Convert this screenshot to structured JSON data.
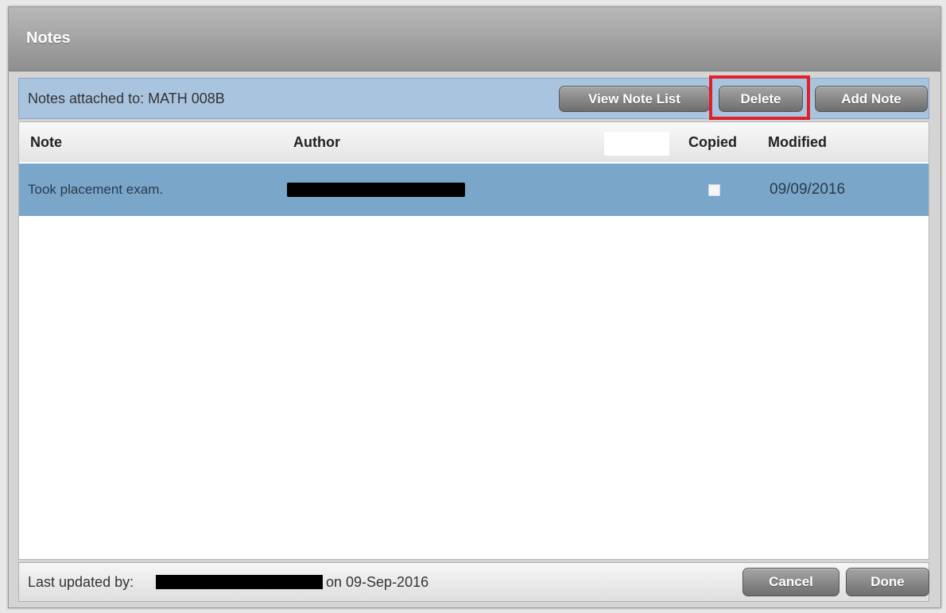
{
  "dialog": {
    "title": "Notes"
  },
  "attach_bar": {
    "label": "Notes attached to:  MATH 008B",
    "buttons": {
      "view_note_list": "View Note List",
      "delete": "Delete",
      "add_note": "Add Note"
    },
    "highlight_color": "#e0202a"
  },
  "table": {
    "columns": [
      "Note",
      "Author",
      "Copied",
      "Modified"
    ],
    "rows": [
      {
        "note": "Took placement exam.",
        "author": "[redacted]",
        "copied": false,
        "modified": "09/09/2016",
        "selected": true
      }
    ],
    "selected_row_color": "#7aa6c9"
  },
  "footer": {
    "prefix": "Last updated by:",
    "user": "[redacted]",
    "suffix": "on 09-Sep-2016",
    "buttons": {
      "cancel": "Cancel",
      "done": "Done"
    }
  }
}
